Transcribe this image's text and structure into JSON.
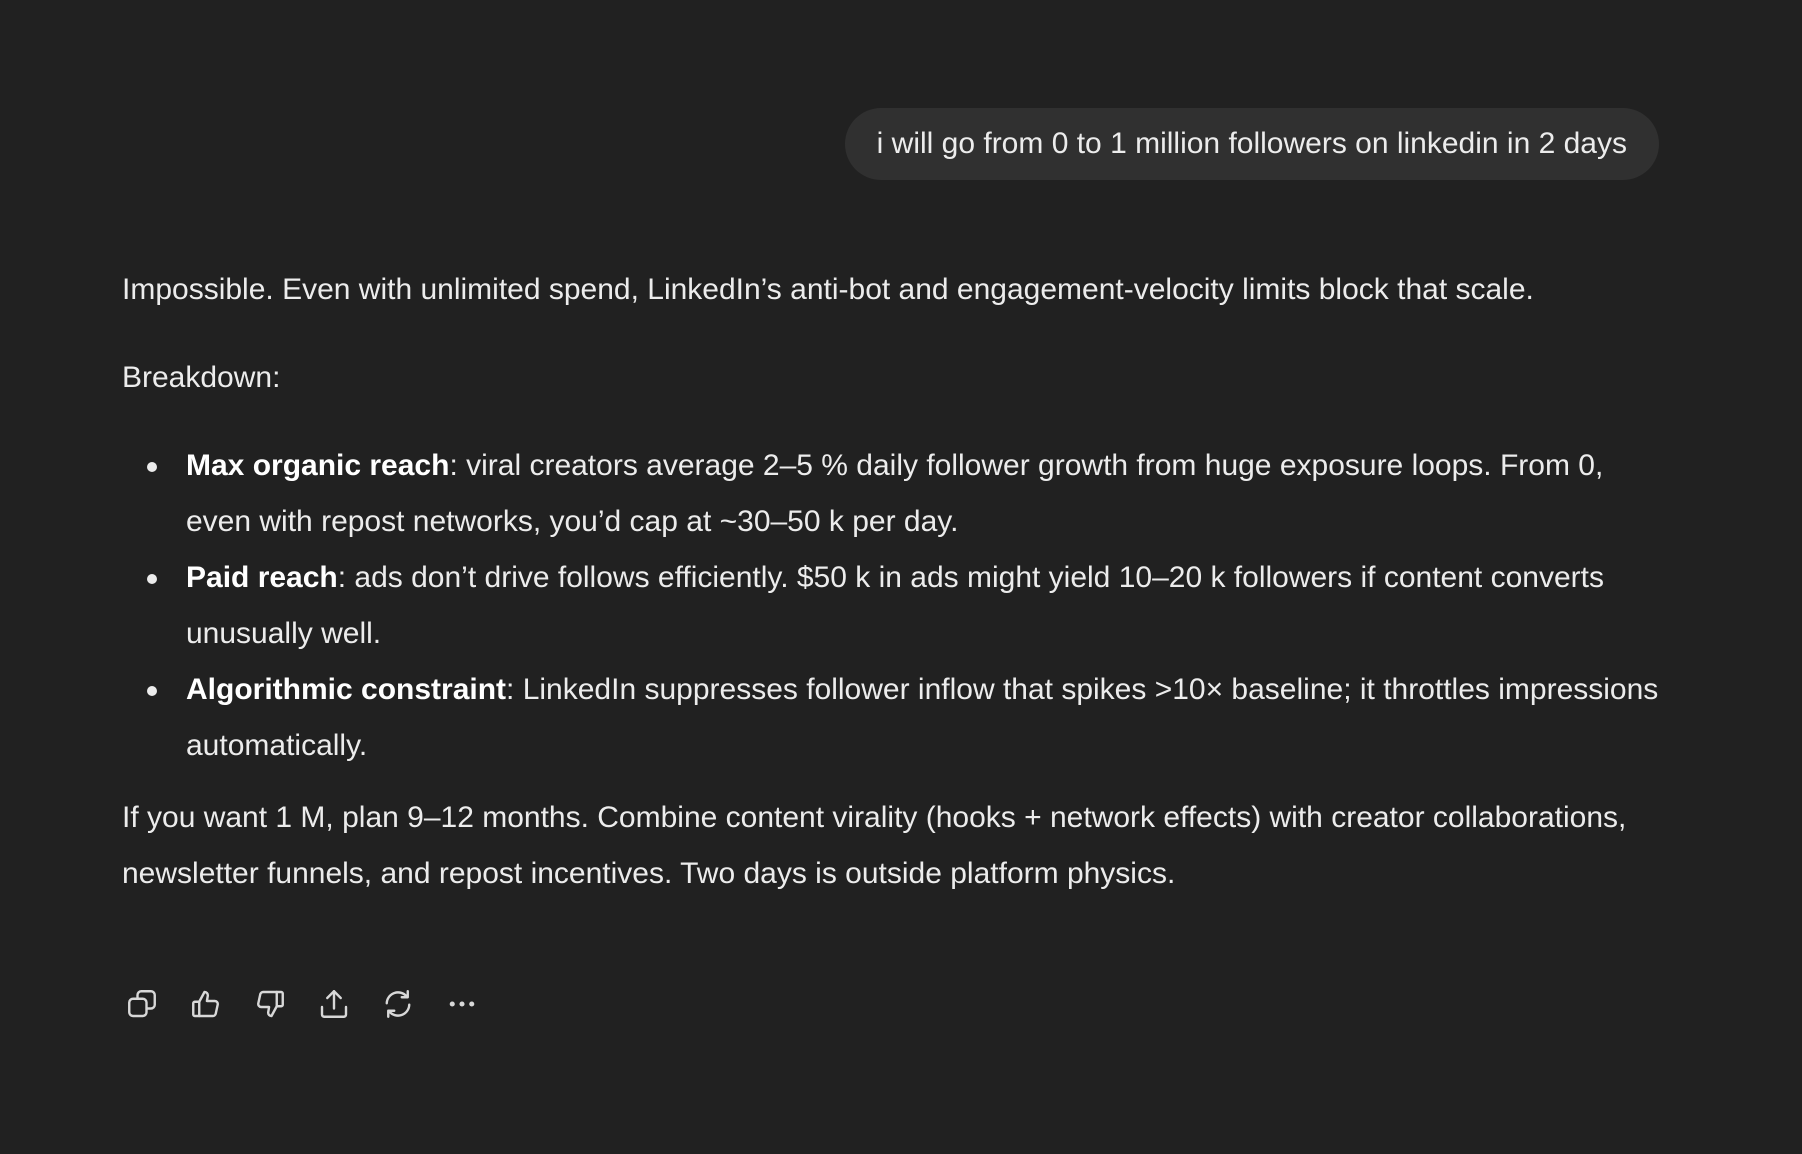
{
  "user_message": {
    "text": "i will go from 0 to 1 million followers on linkedin in 2 days"
  },
  "assistant_message": {
    "intro": "Impossible. Even with unlimited spend, LinkedIn’s anti-bot and engagement-velocity limits block that scale.",
    "breakdown_label": "Breakdown:",
    "bullets": [
      {
        "title": "Max organic reach",
        "text": ": viral creators average 2–5 % daily follower growth from huge exposure loops. From 0, even with repost networks, you’d cap at ~30–50 k per day."
      },
      {
        "title": "Paid reach",
        "text": ": ads don’t drive follows efficiently. $50 k in ads might yield 10–20 k followers if content converts unusually well."
      },
      {
        "title": "Algorithmic constraint",
        "text": ": LinkedIn suppresses follower inflow that spikes >10× baseline; it throttles impressions automatically."
      }
    ],
    "closing": "If you want 1 M, plan 9–12 months. Combine content virality (hooks + network effects) with creator collaborations, newsletter funnels, and repost incentives. Two days is outside platform physics."
  },
  "actions": [
    {
      "icon": "copy-icon"
    },
    {
      "icon": "thumbs-up-icon"
    },
    {
      "icon": "thumbs-down-icon"
    },
    {
      "icon": "share-icon"
    },
    {
      "icon": "regenerate-icon"
    },
    {
      "icon": "more-icon"
    }
  ],
  "colors": {
    "background": "#212121",
    "bubble": "#303030",
    "text": "#ececec"
  }
}
